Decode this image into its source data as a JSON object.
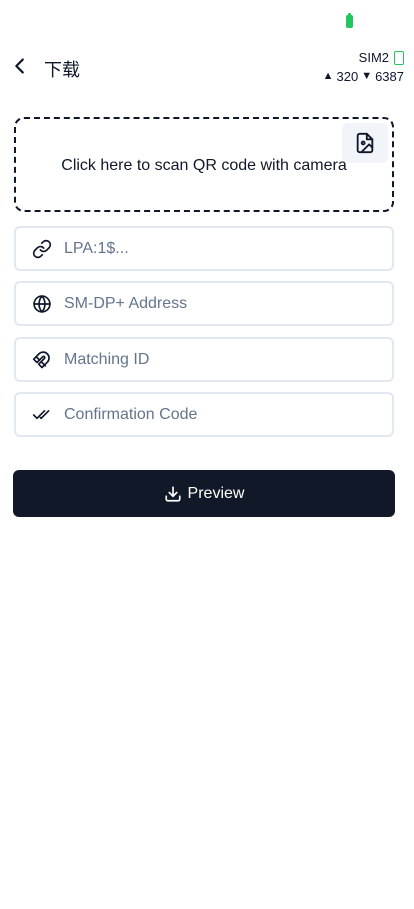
{
  "status_bar": {
    "battery_color": "#22c55e"
  },
  "header": {
    "title": "下载",
    "sim_label": "SIM2",
    "upload": "320",
    "download": "6387"
  },
  "scan": {
    "prompt": "Click here to scan QR code with camera"
  },
  "fields": {
    "lpa_placeholder": "LPA:1$...",
    "smdp_placeholder": "SM-DP+ Address",
    "matching_id_placeholder": "Matching ID",
    "confirmation_code_placeholder": "Confirmation Code"
  },
  "actions": {
    "preview_label": "Preview"
  },
  "icons": {
    "back": "chevron-left-icon",
    "image": "image-file-icon",
    "lpa": "link-icon",
    "smdp": "globe-icon",
    "matching_id": "magnet-icon",
    "confirmation": "double-check-icon",
    "preview": "download-icon"
  }
}
